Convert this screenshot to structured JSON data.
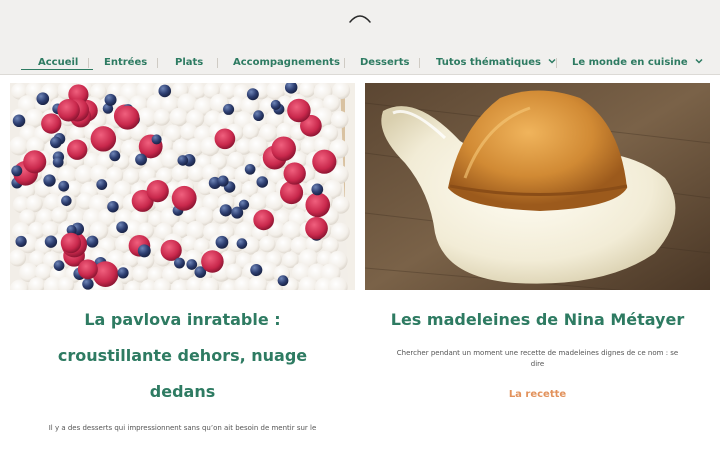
{
  "nav": {
    "items": [
      {
        "label": "Accueil",
        "has_menu": false,
        "active": true
      },
      {
        "label": "Entrées",
        "has_menu": false
      },
      {
        "label": "Plats",
        "has_menu": false
      },
      {
        "label": "Accompagnements",
        "has_menu": false
      },
      {
        "label": "Desserts",
        "has_menu": false
      },
      {
        "label": "Tutos thématiques",
        "has_menu": true
      },
      {
        "label": "Le monde en cuisine",
        "has_menu": true
      }
    ]
  },
  "posts": [
    {
      "title": "La pavlova inratable : croustillante dehors, nuage dedans",
      "title_lines": [
        "La pavlova inratable :",
        "croustillante dehors, nuage",
        "dedans"
      ],
      "excerpt": "Il y a des desserts qui impressionnent sans qu’on ait besoin de mentir sur le",
      "image": "pavlova-with-raspberries-and-blueberries"
    },
    {
      "title": "Les madeleines de Nina Métayer",
      "excerpt_lines": [
        "Chercher pendant un moment une recette de madeleines dignes de ce nom : se",
        "dire"
      ],
      "link_label": "La recette",
      "image": "madeleine-on-white-spoon"
    }
  ],
  "colors": {
    "brand_green": "#2e7b62",
    "link_orange": "#e2925c",
    "header_bg": "#f1f0ee"
  }
}
